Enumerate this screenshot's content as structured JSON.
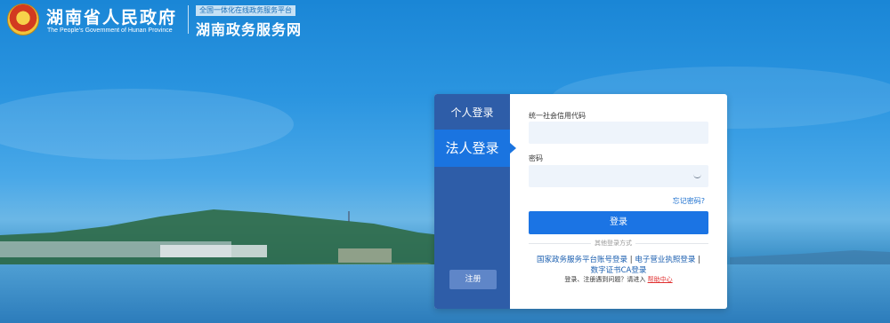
{
  "header": {
    "gov_title": "湖南省人民政府",
    "gov_subtitle": "The People's Government of Hunan Province",
    "platform_tag": "全国一体化在线政务服务平台",
    "platform_name": "湖南政务服务网"
  },
  "login": {
    "tabs": [
      {
        "label": "个人登录",
        "active": false
      },
      {
        "label": "法人登录",
        "active": true
      }
    ],
    "register_label": "注册",
    "code_label": "统一社会信用代码",
    "code_value": "",
    "password_label": "密码",
    "password_value": "",
    "forgot_label": "忘记密码?",
    "submit_label": "登录",
    "other_methods_label": "其他登录方式",
    "alt_methods": [
      "国家政务服务平台账号登录",
      "电子营业执照登录",
      "数字证书CA登录"
    ],
    "alt_separator": "|",
    "help_prefix": "登录、注册遇到问题？请进入",
    "help_link": "帮助中心"
  },
  "colors": {
    "primary": "#1b74e4",
    "sidebar": "#2e5da8",
    "active_tab": "#1a74e0",
    "help_link": "#e03030"
  }
}
